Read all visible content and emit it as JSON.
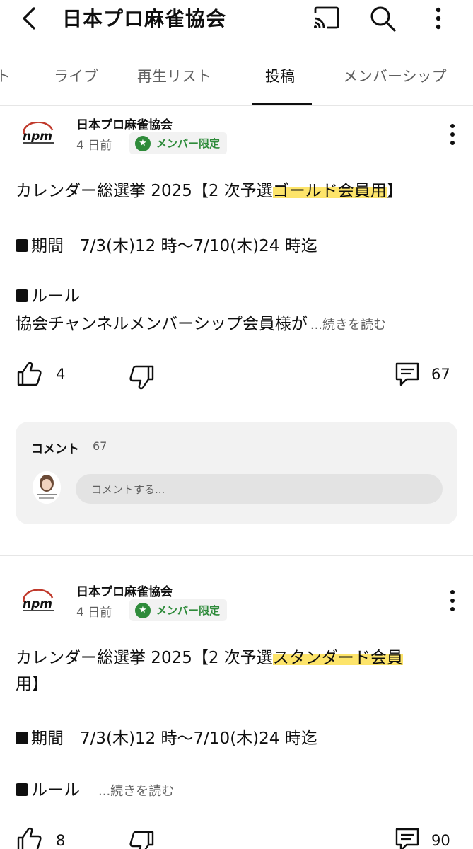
{
  "header": {
    "title": "日本プロ麻雀協会",
    "icons": [
      "back-arrow-icon",
      "cast-icon",
      "search-icon",
      "more-vert-icon"
    ]
  },
  "tabs": [
    {
      "label": "ト",
      "active": false
    },
    {
      "label": "ライブ",
      "active": false
    },
    {
      "label": "再生リスト",
      "active": false
    },
    {
      "label": "投稿",
      "active": true
    },
    {
      "label": "メンバーシップ",
      "active": false
    }
  ],
  "posts": [
    {
      "channel": "日本プロ麻雀協会",
      "age": "4 日前",
      "badge": "メンバー限定",
      "line1_pre": "カレンダー総選挙 2025【2 次予選",
      "line1_hl": "ゴールド会員用",
      "line1_post": "】",
      "period": "期間　7/3(木)12 時〜7/10(木)24 時迄",
      "rule": "ルール",
      "line_last": "協会チャンネルメンバーシップ会員様が",
      "readmore": "...続きを読む",
      "likes": "4",
      "comments": "67",
      "comment_section": {
        "title": "コメント",
        "count": "67",
        "placeholder": "コメントする..."
      }
    },
    {
      "channel": "日本プロ麻雀協会",
      "age": "4 日前",
      "badge": "メンバー限定",
      "line1_pre": "カレンダー総選挙 2025【2 次予選",
      "line1_hl": "スタンダード会員",
      "line2": "用】",
      "period": "期間　7/3(木)12 時〜7/10(木)24 時迄",
      "rule": "ルール",
      "readmore": "...続きを読む",
      "likes": "8",
      "comments": "90"
    }
  ],
  "colors": {
    "accent_green": "#2e8b3a",
    "highlight_yellow": "#fde46a",
    "card_bg": "#f2f2f2"
  }
}
